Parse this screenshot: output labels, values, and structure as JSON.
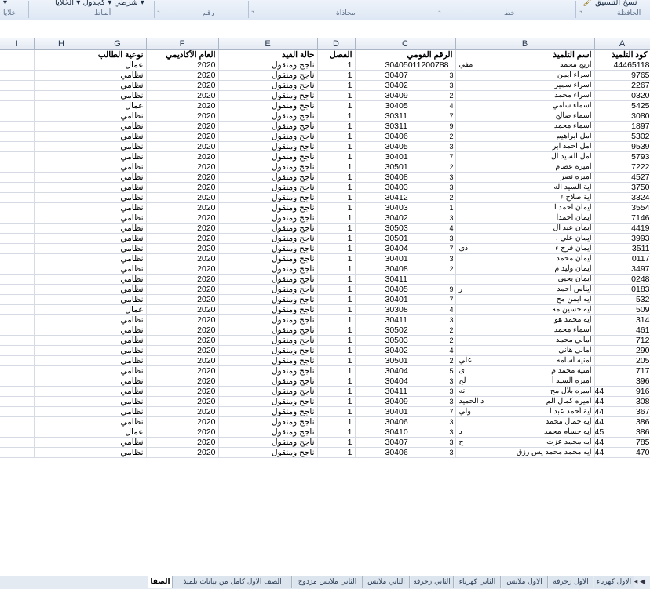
{
  "ribbon": {
    "clipboard_label": "الحافظة",
    "font_label": "خط",
    "alignment_label": "محاذاة",
    "number_label": "رقم",
    "styles_label": "أنماط",
    "cells_label": "خلايا",
    "format_painter_label": "نسخ التنسيق",
    "styles_buttons": "شرطي ▾ كجدول ▾ الخلايا ▾"
  },
  "columns": [
    "I",
    "H",
    "G",
    "F",
    "E",
    "D",
    "C",
    "B",
    "A"
  ],
  "headers": {
    "a": "كود التلميذ",
    "b": "اسم التلميذ",
    "c": "الرقم القومي",
    "d": "الفصل",
    "e": "حالة القيد",
    "f": "العام الأكاديمي",
    "g": "نوعية الطالب"
  },
  "rows": [
    {
      "a": "44465118",
      "b": "اريج محمد",
      "bx": "مفي",
      "c": "30405011200788",
      "cs": "",
      "d": "1",
      "e": "ناجح ومنقول",
      "f": "2020",
      "g": "عمال",
      "n": ""
    },
    {
      "a": "9765",
      "b": "اسراء ايمن",
      "bx": "",
      "c": "30407",
      "cs": "3",
      "d": "1",
      "e": "ناجح ومنقول",
      "f": "2020",
      "g": "نظامي",
      "n": ""
    },
    {
      "a": "2267",
      "b": "اسراء سمير",
      "bx": "",
      "c": "30402",
      "cs": "3",
      "d": "1",
      "e": "ناجح ومنقول",
      "f": "2020",
      "g": "نظامي",
      "n": ""
    },
    {
      "a": "0320",
      "b": "اسراء محمد",
      "bx": "",
      "c": "30409",
      "cs": "2",
      "d": "1",
      "e": "ناجح ومنقول",
      "f": "2020",
      "g": "نظامي",
      "n": ""
    },
    {
      "a": "5425",
      "b": "اسماء سامي",
      "bx": "",
      "c": "30405",
      "cs": "4",
      "d": "1",
      "e": "ناجح ومنقول",
      "f": "2020",
      "g": "عمال",
      "n": ""
    },
    {
      "a": "3080",
      "b": "اسماء صالح",
      "bx": "",
      "c": "30311",
      "cs": "7",
      "d": "1",
      "e": "ناجح ومنقول",
      "f": "2020",
      "g": "نظامي",
      "n": ""
    },
    {
      "a": "1897",
      "b": "اسماء محمد",
      "bx": "",
      "c": "30311",
      "cs": "9",
      "d": "1",
      "e": "ناجح ومنقول",
      "f": "2020",
      "g": "نظامي",
      "n": ""
    },
    {
      "a": "5302",
      "b": "امل ابراهيم",
      "bx": "",
      "c": "30406",
      "cs": "2",
      "d": "1",
      "e": "ناجح ومنقول",
      "f": "2020",
      "g": "نظامي",
      "n": ""
    },
    {
      "a": "9539",
      "b": "امل احمد ابر",
      "bx": "",
      "c": "30405",
      "cs": "3",
      "d": "1",
      "e": "ناجح ومنقول",
      "f": "2020",
      "g": "نظامي",
      "n": ""
    },
    {
      "a": "5793",
      "b": "امل السيد ال",
      "bx": "",
      "c": "30401",
      "cs": "7",
      "d": "1",
      "e": "ناجح ومنقول",
      "f": "2020",
      "g": "نظامي",
      "n": ""
    },
    {
      "a": "7222",
      "b": "اميرة عصام",
      "bx": "",
      "c": "30501",
      "cs": "2",
      "d": "1",
      "e": "ناجح ومنقول",
      "f": "2020",
      "g": "نظامي",
      "n": ""
    },
    {
      "a": "4527",
      "b": "اميره نصر",
      "bx": "",
      "c": "30408",
      "cs": "3",
      "d": "1",
      "e": "ناجح ومنقول",
      "f": "2020",
      "g": "نظامي",
      "n": ""
    },
    {
      "a": "3750",
      "b": "اية السيد اله",
      "bx": "",
      "c": "30403",
      "cs": "3",
      "d": "1",
      "e": "ناجح ومنقول",
      "f": "2020",
      "g": "نظامي",
      "n": ""
    },
    {
      "a": "3324",
      "b": "اية صلاح ء",
      "bx": "",
      "c": "30412",
      "cs": "2",
      "d": "1",
      "e": "ناجح ومنقول",
      "f": "2020",
      "g": "نظامي",
      "n": ""
    },
    {
      "a": "3554",
      "b": "ايمان احمد ا",
      "bx": "",
      "c": "30403",
      "cs": "1",
      "d": "1",
      "e": "ناجح ومنقول",
      "f": "2020",
      "g": "نظامي",
      "n": ""
    },
    {
      "a": "7146",
      "b": "ايمان احمدأ",
      "bx": "",
      "c": "30402",
      "cs": "3",
      "d": "1",
      "e": "ناجح ومنقول",
      "f": "2020",
      "g": "نظامي",
      "n": ""
    },
    {
      "a": "4419",
      "b": "ايمان عبد ال",
      "bx": "",
      "c": "30503",
      "cs": "4",
      "d": "1",
      "e": "ناجح ومنقول",
      "f": "2020",
      "g": "نظامي",
      "n": ""
    },
    {
      "a": "3993",
      "b": "ايمان علي ،",
      "bx": "",
      "c": "30501",
      "cs": "3",
      "d": "1",
      "e": "ناجح ومنقول",
      "f": "2020",
      "g": "نظامي",
      "n": ""
    },
    {
      "a": "3511",
      "b": "ايمان فرج ء",
      "bx": "ذى",
      "c": "30404",
      "cs": "7",
      "d": "1",
      "e": "ناجح ومنقول",
      "f": "2020",
      "g": "نظامي",
      "n": ""
    },
    {
      "a": "0117",
      "b": "ايمان محمد",
      "bx": "",
      "c": "30401",
      "cs": "3",
      "d": "1",
      "e": "ناجح ومنقول",
      "f": "2020",
      "g": "نظامي",
      "n": ""
    },
    {
      "a": "3497",
      "b": "ايمان وليد م",
      "bx": "",
      "c": "30408",
      "cs": "2",
      "d": "1",
      "e": "ناجح ومنقول",
      "f": "2020",
      "g": "نظامي",
      "n": ""
    },
    {
      "a": "0248",
      "b": "ايمان يحيى",
      "bx": "",
      "c": "30411",
      "cs": "",
      "d": "1",
      "e": "ناجح ومنقول",
      "f": "2020",
      "g": "نظامي",
      "n": ""
    },
    {
      "a": "0183",
      "b": "ايناس احمد",
      "bx": "ر",
      "c": "30405",
      "cs": "9",
      "d": "1",
      "e": "ناجح ومنقول",
      "f": "2020",
      "g": "نظامي",
      "n": ""
    },
    {
      "a": "532",
      "b": "ايه ايمن مح",
      "bx": "",
      "c": "30401",
      "cs": "7",
      "d": "1",
      "e": "ناجح ومنقول",
      "f": "2020",
      "g": "نظامي",
      "n": ""
    },
    {
      "a": "509",
      "b": "ايه حسين مه",
      "bx": "",
      "c": "30308",
      "cs": "4",
      "d": "1",
      "e": "ناجح ومنقول",
      "f": "2020",
      "g": "عمال",
      "n": ""
    },
    {
      "a": "314",
      "b": "ايه محمد هو",
      "bx": "",
      "c": "30411",
      "cs": "3",
      "d": "1",
      "e": "ناجح ومنقول",
      "f": "2020",
      "g": "نظامي",
      "n": ""
    },
    {
      "a": "461",
      "b": "أسماء محمد",
      "bx": "",
      "c": "30502",
      "cs": "2",
      "d": "1",
      "e": "ناجح ومنقول",
      "f": "2020",
      "g": "نظامي",
      "n": ""
    },
    {
      "a": "712",
      "b": "أماني محمد",
      "bx": "",
      "c": "30503",
      "cs": "2",
      "d": "1",
      "e": "ناجح ومنقول",
      "f": "2020",
      "g": "نظامي",
      "n": ""
    },
    {
      "a": "290",
      "b": "أماني هاني",
      "bx": "",
      "c": "30402",
      "cs": "4",
      "d": "1",
      "e": "ناجح ومنقول",
      "f": "2020",
      "g": "نظامي",
      "n": ""
    },
    {
      "a": "205",
      "b": "أمنيه أسامه",
      "bx": "علي",
      "c": "30501",
      "cs": "2",
      "d": "1",
      "e": "ناجح ومنقول",
      "f": "2020",
      "g": "نظامي",
      "n": ""
    },
    {
      "a": "717",
      "b": "أمنيه محمد م",
      "bx": "ى",
      "c": "30404",
      "cs": "5",
      "d": "1",
      "e": "ناجح ومنقول",
      "f": "2020",
      "g": "نظامي",
      "n": ""
    },
    {
      "a": "396",
      "b": "أميره السيد أ",
      "bx": "لح",
      "c": "30404",
      "cs": "3",
      "d": "1",
      "e": "ناجح ومنقول",
      "f": "2020",
      "g": "نظامي",
      "n": ""
    },
    {
      "a": "916",
      "b": "أميره بلال مح",
      "bx": "نه",
      "c": "30411",
      "cs": "3",
      "d": "1",
      "e": "ناجح ومنقول",
      "f": "2020",
      "g": "نظامي",
      "n": "44"
    },
    {
      "a": "308",
      "b": "أميره كمال الم",
      "bx": "د الحميد",
      "c": "30409",
      "cs": "3",
      "d": "1",
      "e": "ناجح ومنقول",
      "f": "2020",
      "g": "نظامي",
      "n": "44"
    },
    {
      "a": "367",
      "b": "أية أحمد عبد ا",
      "bx": "ولي",
      "c": "30401",
      "cs": "7",
      "d": "1",
      "e": "ناجح ومنقول",
      "f": "2020",
      "g": "نظامي",
      "n": "44"
    },
    {
      "a": "386",
      "b": "أية جمال محمد",
      "bx": "",
      "c": "30406",
      "cs": "3",
      "d": "1",
      "e": "ناجح ومنقول",
      "f": "2020",
      "g": "نظامي",
      "n": "44"
    },
    {
      "a": "386",
      "b": "أيه حسام محمد",
      "bx": "د",
      "c": "30410",
      "cs": "3",
      "d": "1",
      "e": "ناجح ومنقول",
      "f": "2020",
      "g": "عمال",
      "n": "45"
    },
    {
      "a": "785",
      "b": "أيه محمد عزت",
      "bx": "ج",
      "c": "30407",
      "cs": "3",
      "d": "1",
      "e": "ناجح ومنقول",
      "f": "2020",
      "g": "نظامي",
      "n": "44"
    },
    {
      "a": "470",
      "b": "أيه محمد محمد يس رزق",
      "bx": "",
      "c": "30406",
      "cs": "3",
      "d": "1",
      "e": "ناجح ومنقول",
      "f": "2020",
      "g": "نظامي",
      "n": "44"
    }
  ],
  "tabs": [
    "الاول كهرباء",
    "الاول زخرفة",
    "الاول ملابس",
    "الثاني كهرباء",
    "الثاني زخرفة",
    "الثاني ملابس",
    "الثاني ملابس مزدوج",
    "الصف الاول كامل من بيانات تلميذ",
    "الصفا"
  ],
  "nav": "◂ ◀"
}
